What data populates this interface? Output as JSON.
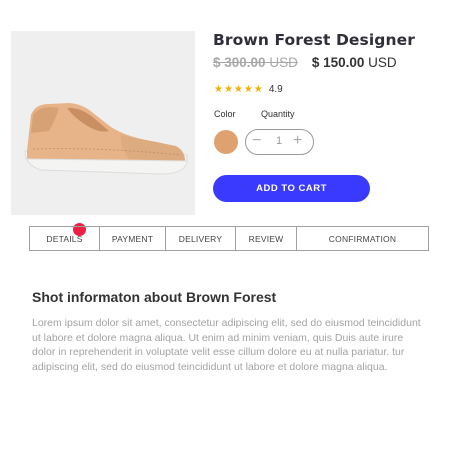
{
  "product": {
    "title": "Brown Forest Designer",
    "old_price": "$ 300.00",
    "old_price_currency": "USD",
    "new_price": "$ 150.00",
    "new_price_currency": "USD",
    "rating_stars": "★★★★★",
    "rating_value": "4.9",
    "image_icon": "sneaker-image"
  },
  "options": {
    "color_label": "Color",
    "quantity_label": "Quantity",
    "selected_color": "#dfa16f",
    "quantity_value": "1",
    "minus_symbol": "−",
    "plus_symbol": "+"
  },
  "cart": {
    "button_label": "ADD TO CART",
    "button_color": "#3a3aff"
  },
  "carousel": {
    "active_dot_color": "#ee1f44"
  },
  "tabs": [
    {
      "label": "DETAILS"
    },
    {
      "label": "PAYMENT"
    },
    {
      "label": "DELIVERY"
    },
    {
      "label": "REVIEW"
    },
    {
      "label": "CONFIRMATION"
    }
  ],
  "info": {
    "title": "Shot informaton about Brown Forest",
    "body": "Lorem ipsum dolor sit amet, consectetur adipiscing elit, sed do eiusmod teincididunt ut labore et dolore magna aliqua. Ut enim ad minim veniam, quis Duis aute irure dolor in reprehenderit in voluptate velit esse cillum dolore eu at nulla pariatur. tur adipiscing elit, sed do eiusmod teincididunt ut labore et dolore magna aliqua."
  }
}
